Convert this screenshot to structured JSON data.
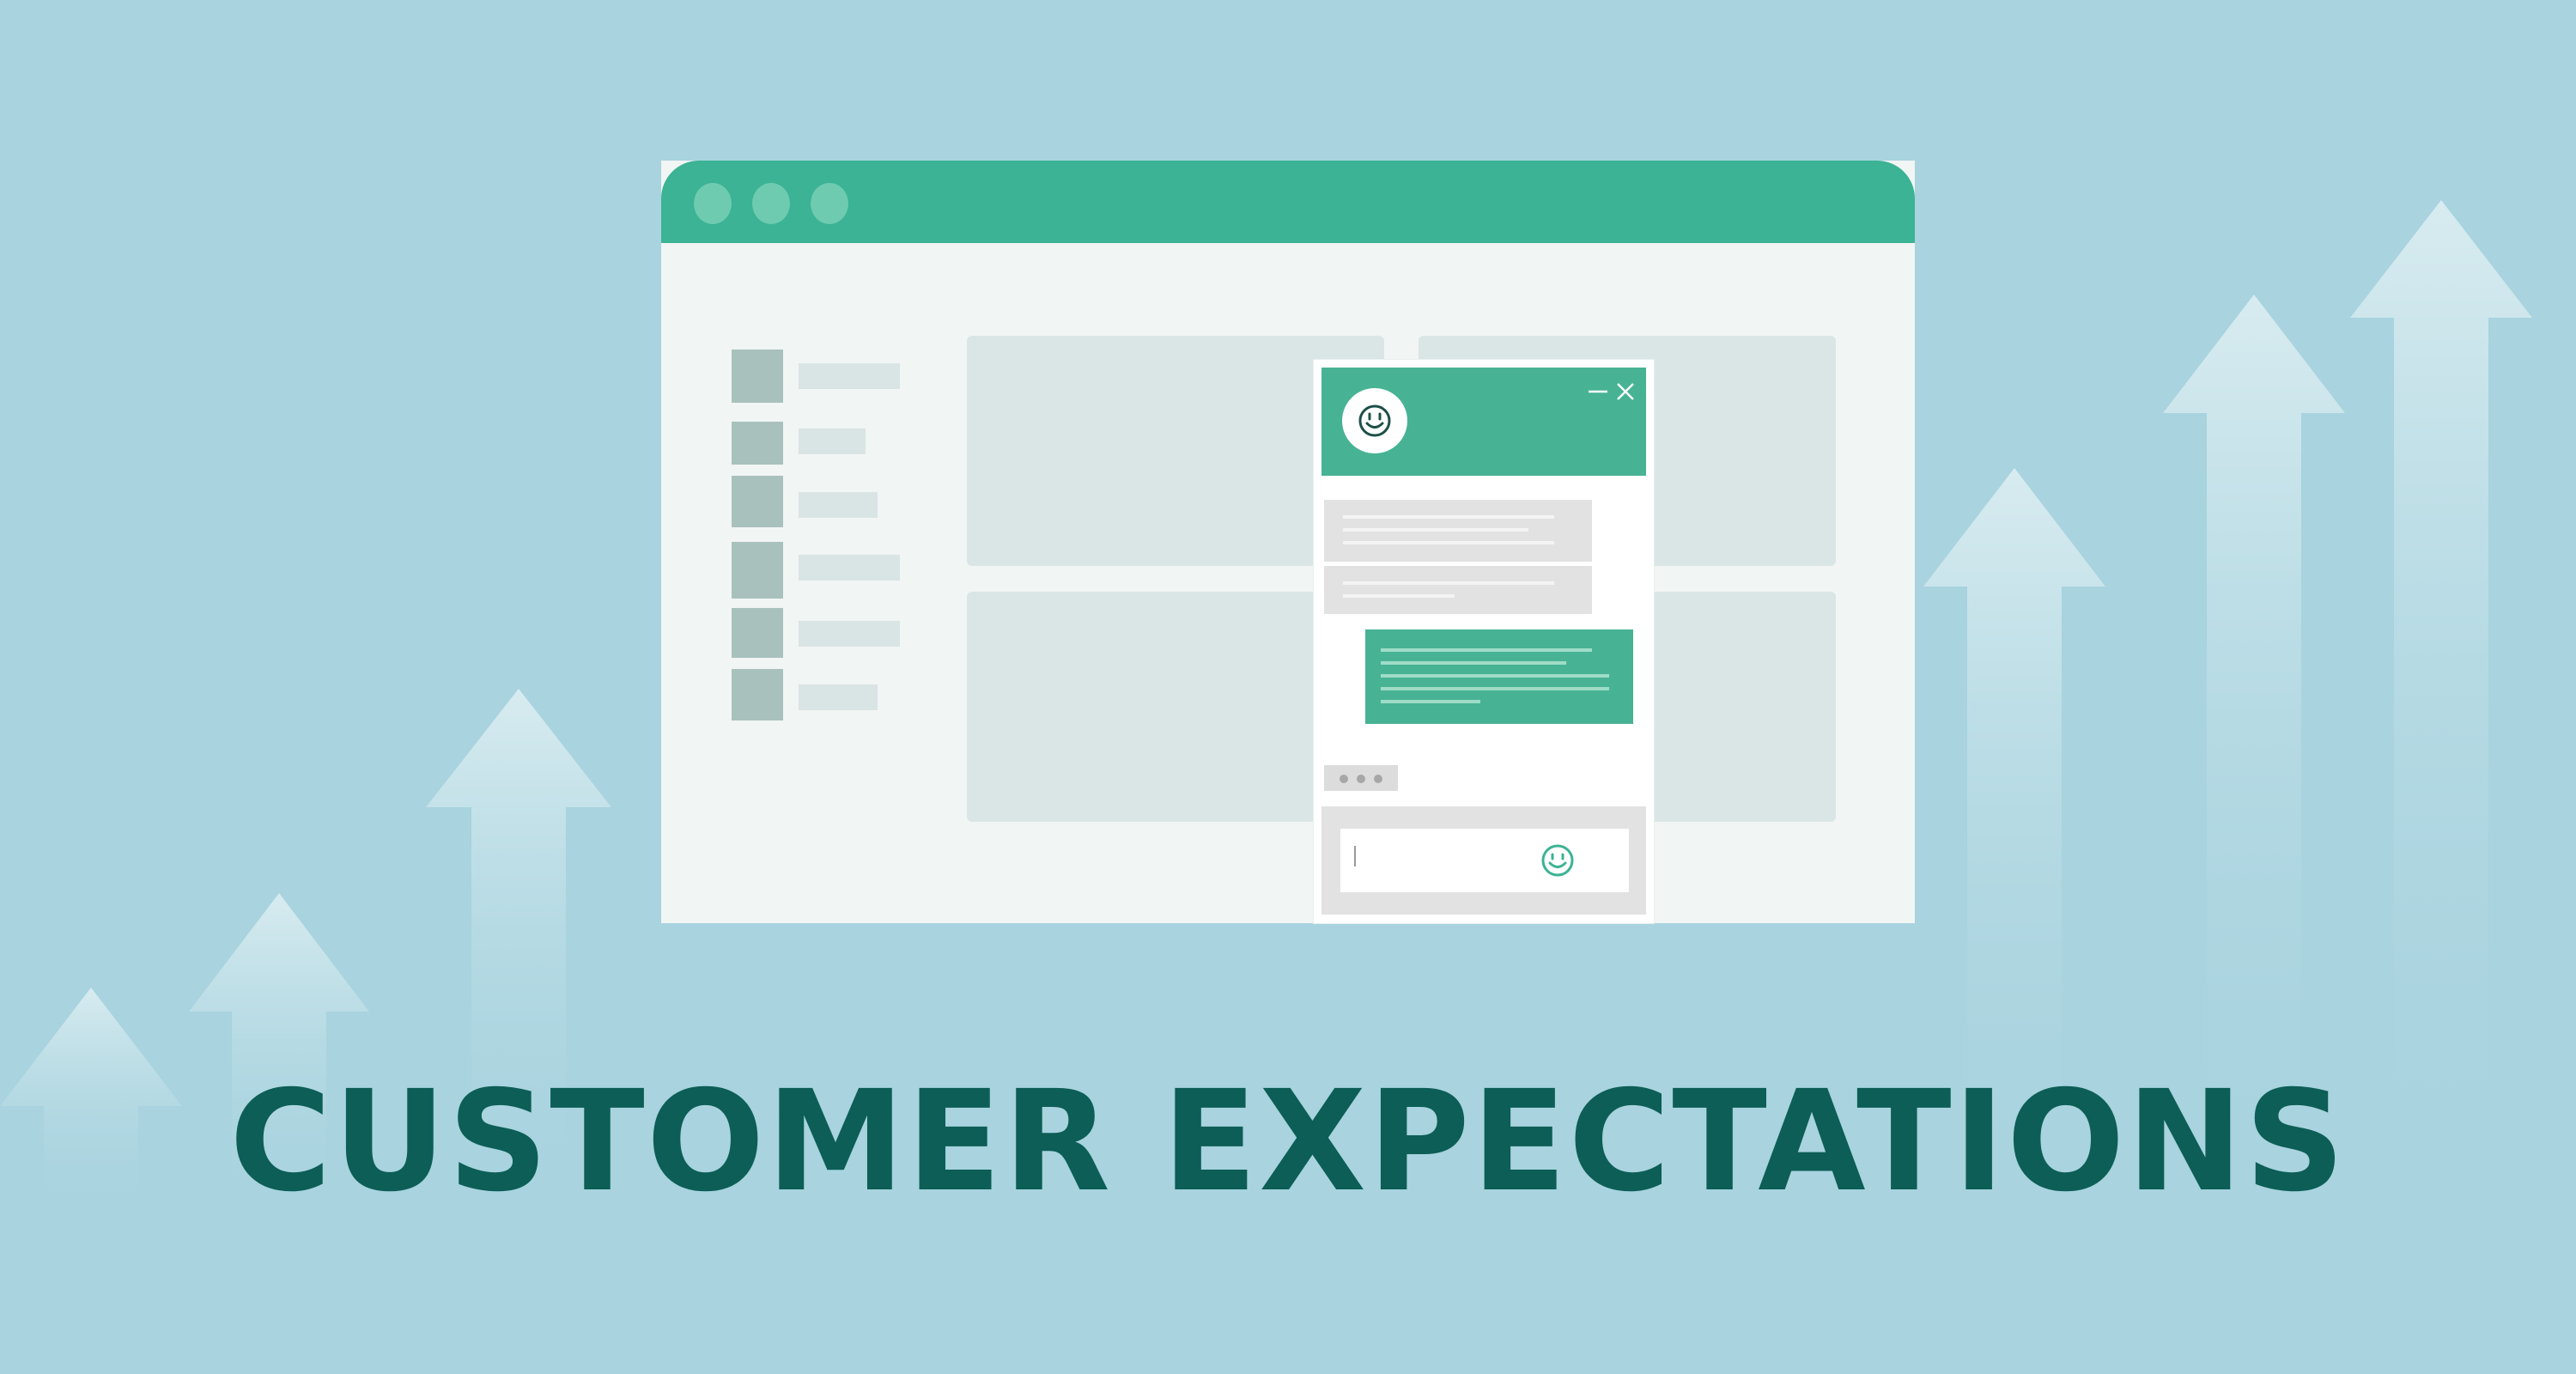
{
  "headline": "CUSTOMER EXPECTATIONS",
  "colors": {
    "background": "#a8d3df",
    "accent": "#3bb394",
    "headline": "#0c5e56",
    "window": "#f1f5f4"
  },
  "icons": {
    "chat_avatar": "smiley-icon",
    "minimize": "minimize-icon",
    "close": "close-icon",
    "input_emoji": "smiley-icon",
    "background": "up-arrow-icon"
  }
}
